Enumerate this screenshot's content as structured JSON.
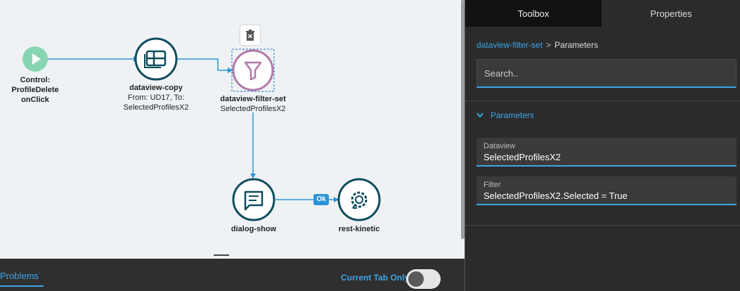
{
  "canvas": {
    "nodes": {
      "start": {
        "label_line1": "Control:",
        "label_line2": "ProfileDelete",
        "label_line3": "onClick"
      },
      "copy": {
        "title": "dataview-copy",
        "line2": "From: UD17, To:",
        "line3": "SelectedProfilesX2"
      },
      "filter": {
        "title": "dataview-filter-set",
        "line2": "SelectedProfilesX2"
      },
      "dialog": {
        "title": "dialog-show"
      },
      "rest": {
        "title": "rest-kinetic"
      }
    },
    "edge_ok_label": "Ok",
    "colors": {
      "teal_dark": "#0e4c5c",
      "start_green": "#88d5b3",
      "filter_purple": "#b07aa8",
      "edge_blue": "#2b95d6"
    }
  },
  "bottom": {
    "problems_tab": "Problems",
    "current_tab_only": "Current Tab Only"
  },
  "panel": {
    "tabs": {
      "toolbox": "Toolbox",
      "properties": "Properties"
    },
    "breadcrumb": {
      "link": "dataview-filter-set",
      "separator": ">",
      "current": "Parameters"
    },
    "search_placeholder": "Search..",
    "section_title": "Parameters",
    "fields": [
      {
        "label": "Dataview",
        "value": "SelectedProfilesX2"
      },
      {
        "label": "Filter",
        "value": "SelectedProfilesX2.Selected = True"
      }
    ]
  }
}
